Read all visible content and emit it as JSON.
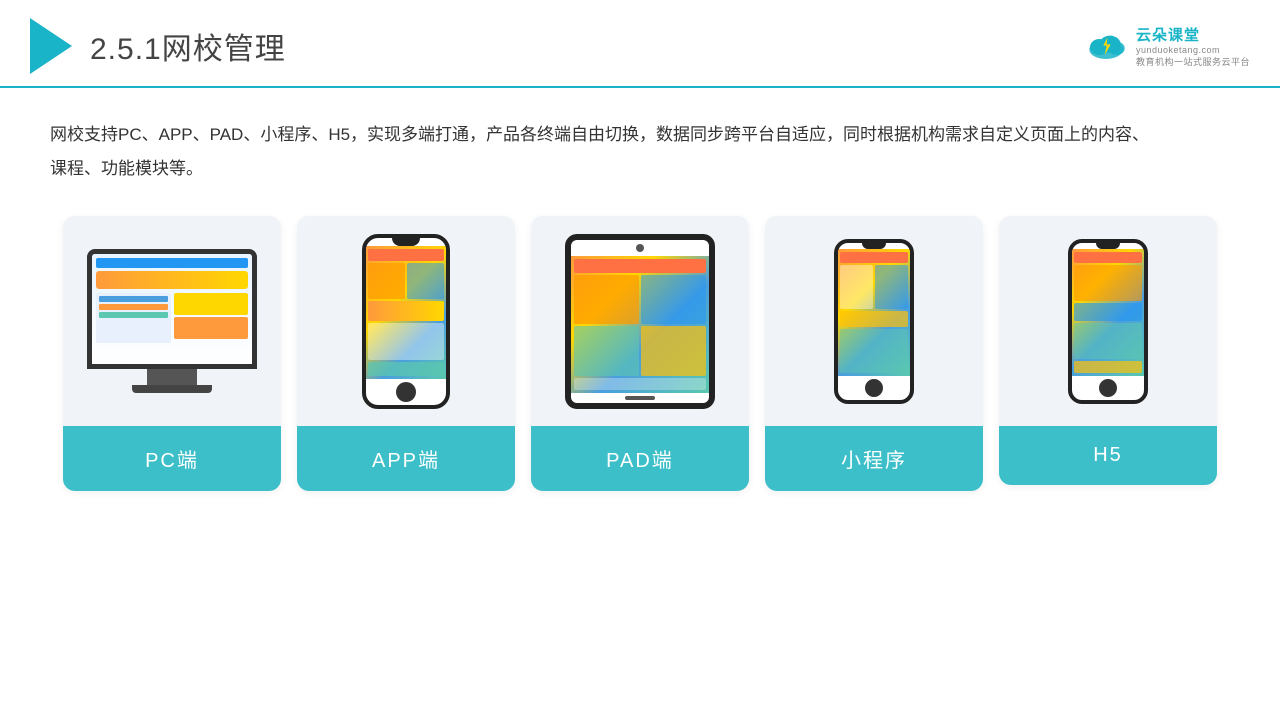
{
  "header": {
    "section_number": "2.5.1",
    "title": "网校管理",
    "logo_name": "云朵课堂",
    "logo_url": "yunduoketang.com",
    "logo_tagline": "教育机构一站式服务云平台"
  },
  "description": "网校支持PC、APP、PAD、小程序、H5，实现多端打通，产品各终端自由切换，数据同步跨平台自适应，同时根据机构需求自定义页面上的内容、课程、功能模块等。",
  "cards": [
    {
      "id": "pc",
      "label": "PC端"
    },
    {
      "id": "app",
      "label": "APP端"
    },
    {
      "id": "pad",
      "label": "PAD端"
    },
    {
      "id": "mini-program",
      "label": "小程序"
    },
    {
      "id": "h5",
      "label": "H5"
    }
  ],
  "colors": {
    "accent": "#1ab4c8",
    "card_bg": "#f0f4f8",
    "card_label": "#3cbfc8",
    "border_bottom": "#1ab4c8"
  }
}
